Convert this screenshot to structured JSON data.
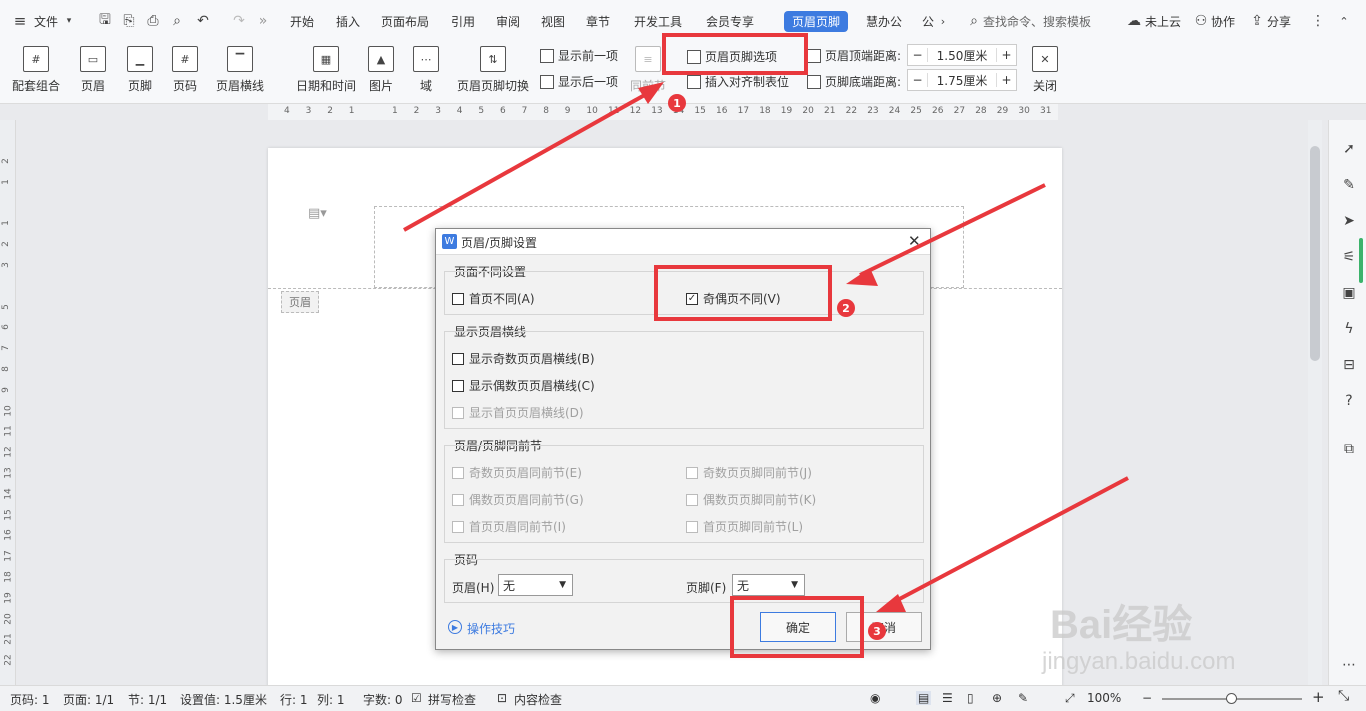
{
  "menubar": {
    "file": "文件",
    "tabs": [
      "开始",
      "插入",
      "页面布局",
      "引用",
      "审阅",
      "视图",
      "章节",
      "开发工具",
      "会员专享",
      "页眉页脚",
      "慧办公",
      "公"
    ],
    "search_placeholder": "查找命令、搜索模板",
    "cloud": "未上云",
    "collab": "协作",
    "share": "分享"
  },
  "ribbon": {
    "combo": "配套组合",
    "header": "页眉",
    "footer": "页脚",
    "pagenum": "页码",
    "hline": "页眉横线",
    "datetime": "日期和时间",
    "picture": "图片",
    "field": "域",
    "switch": "页眉页脚切换",
    "show_prev": "显示前一项",
    "show_next": "显示后一项",
    "same_prev": "同前节",
    "hf_options": "页眉页脚选项",
    "insert_tab": "插入对齐制表位",
    "top_dist_label": "页眉顶端距离:",
    "top_dist_value": "1.50厘米",
    "bottom_dist_label": "页脚底端距离:",
    "bottom_dist_value": "1.75厘米",
    "close": "关闭"
  },
  "ruler_top": [
    "4",
    "3",
    "2",
    "1",
    "",
    "1",
    "2",
    "3",
    "4",
    "5",
    "6",
    "7",
    "8",
    "9",
    "10",
    "11",
    "12",
    "13",
    "14",
    "15",
    "16",
    "17",
    "18",
    "19",
    "20",
    "21",
    "22",
    "23",
    "24",
    "25",
    "26",
    "27",
    "28",
    "29",
    "30",
    "31"
  ],
  "ruler_left": [
    "2",
    "1",
    "",
    "1",
    "2",
    "3",
    "",
    "5",
    "6",
    "7",
    "8",
    "9",
    "10",
    "11",
    "12",
    "13",
    "14",
    "15",
    "16",
    "17",
    "18",
    "19",
    "20",
    "21",
    "22"
  ],
  "document": {
    "header_tag": "页眉"
  },
  "dialog": {
    "title": "页眉/页脚设置",
    "g1_title": "页面不同设置",
    "first_diff": "首页不同(A)",
    "odd_even_diff": "奇偶页不同(V)",
    "g2_title": "显示页眉横线",
    "show_odd_line": "显示奇数页页眉横线(B)",
    "show_even_line": "显示偶数页页眉横线(C)",
    "show_first_line": "显示首页页眉横线(D)",
    "g3_title": "页眉/页脚同前节",
    "odd_header_same": "奇数页页眉同前节(E)",
    "odd_footer_same": "奇数页页脚同前节(J)",
    "even_header_same": "偶数页页眉同前节(G)",
    "even_footer_same": "偶数页页脚同前节(K)",
    "first_header_same": "首页页眉同前节(I)",
    "first_footer_same": "首页页脚同前节(L)",
    "g4_title": "页码",
    "header_label": "页眉(H)",
    "header_value": "无",
    "footer_label": "页脚(F)",
    "footer_value": "无",
    "tips": "操作技巧",
    "ok": "确定",
    "cancel": "取消"
  },
  "badges": [
    "1",
    "2",
    "3"
  ],
  "status": {
    "pagecode": "页码: 1",
    "page": "页面: 1/1",
    "section": "节: 1/1",
    "setting": "设置值: 1.5厘米",
    "row": "行: 1",
    "col": "列: 1",
    "words": "字数: 0",
    "spell": "拼写检查",
    "content": "内容检查",
    "zoom": "100%"
  },
  "watermark": {
    "brand": "Bai经验",
    "url": "jingyan.baidu.com"
  },
  "colors": {
    "accent": "#3d7be0",
    "annotation": "#e8383d"
  }
}
